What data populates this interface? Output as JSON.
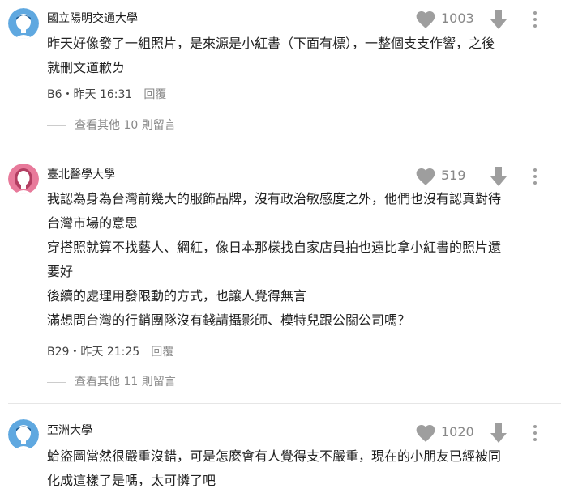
{
  "icons": {
    "like": "heart-icon",
    "dislike": "arrow-down-icon",
    "menu": "more-vertical-icon"
  },
  "colors": {
    "avatar_male": "#5fa8e0",
    "avatar_female": "#e87a9b",
    "icon_gray": "#9e9e9e"
  },
  "comments": [
    {
      "author": "國立陽明交通大學",
      "likes": "1003",
      "lines": [
        "昨天好像發了一組照片，是來源是小紅書（下面有標），一整個支支作響，之後",
        "就刪文道歉ㄌ"
      ],
      "floor_time": "B6・昨天 16:31",
      "reply_label": "回覆",
      "more_replies": "查看其他 10 則留言"
    },
    {
      "author": "臺北醫學大學",
      "likes": "519",
      "lines": [
        "我認為身為台灣前幾大的服飾品牌，沒有政治敏感度之外，他們也沒有認真對待",
        "台灣市場的意思",
        "穿搭照就算不找藝人、網紅，像日本那樣找自家店員拍也遠比拿小紅書的照片還",
        "要好",
        "後續的處理用發限動的方式，也讓人覺得無言",
        "滿想問台灣的行銷團隊沒有錢請攝影師、模特兒跟公關公司嗎？"
      ],
      "floor_time": "B29・昨天 21:25",
      "reply_label": "回覆",
      "more_replies": "查看其他 11 則留言"
    },
    {
      "author": "亞洲大學",
      "likes": "1020",
      "lines": [
        "蛤盜圖當然很嚴重沒錯，可是怎麼會有人覺得支不嚴重，現在的小朋友已經被同",
        "化成這樣了是嗎，太可憐了吧"
      ]
    }
  ]
}
